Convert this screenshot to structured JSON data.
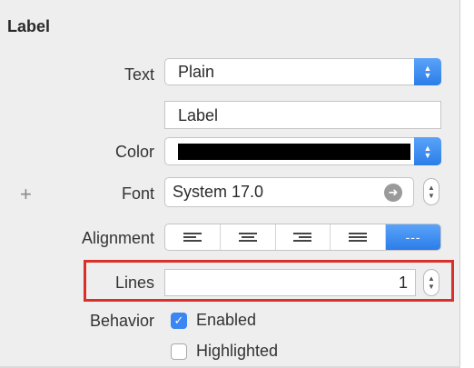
{
  "section": {
    "title": "Label"
  },
  "text": {
    "label": "Text",
    "value": "Plain"
  },
  "content": {
    "value": "Label"
  },
  "color": {
    "label": "Color",
    "swatch": "#000000"
  },
  "font": {
    "label": "Font",
    "value": "System 17.0"
  },
  "alignment": {
    "label": "Alignment",
    "options": [
      "left",
      "center",
      "right",
      "justified",
      "natural"
    ],
    "selected": "natural"
  },
  "lines": {
    "label": "Lines",
    "value": "1"
  },
  "behavior": {
    "label": "Behavior",
    "enabled": {
      "label": "Enabled",
      "checked": true
    },
    "highlighted": {
      "label": "Highlighted",
      "checked": false
    }
  },
  "colors": {
    "accent": "#2b7de9",
    "highlight_border": "#d9302a"
  }
}
